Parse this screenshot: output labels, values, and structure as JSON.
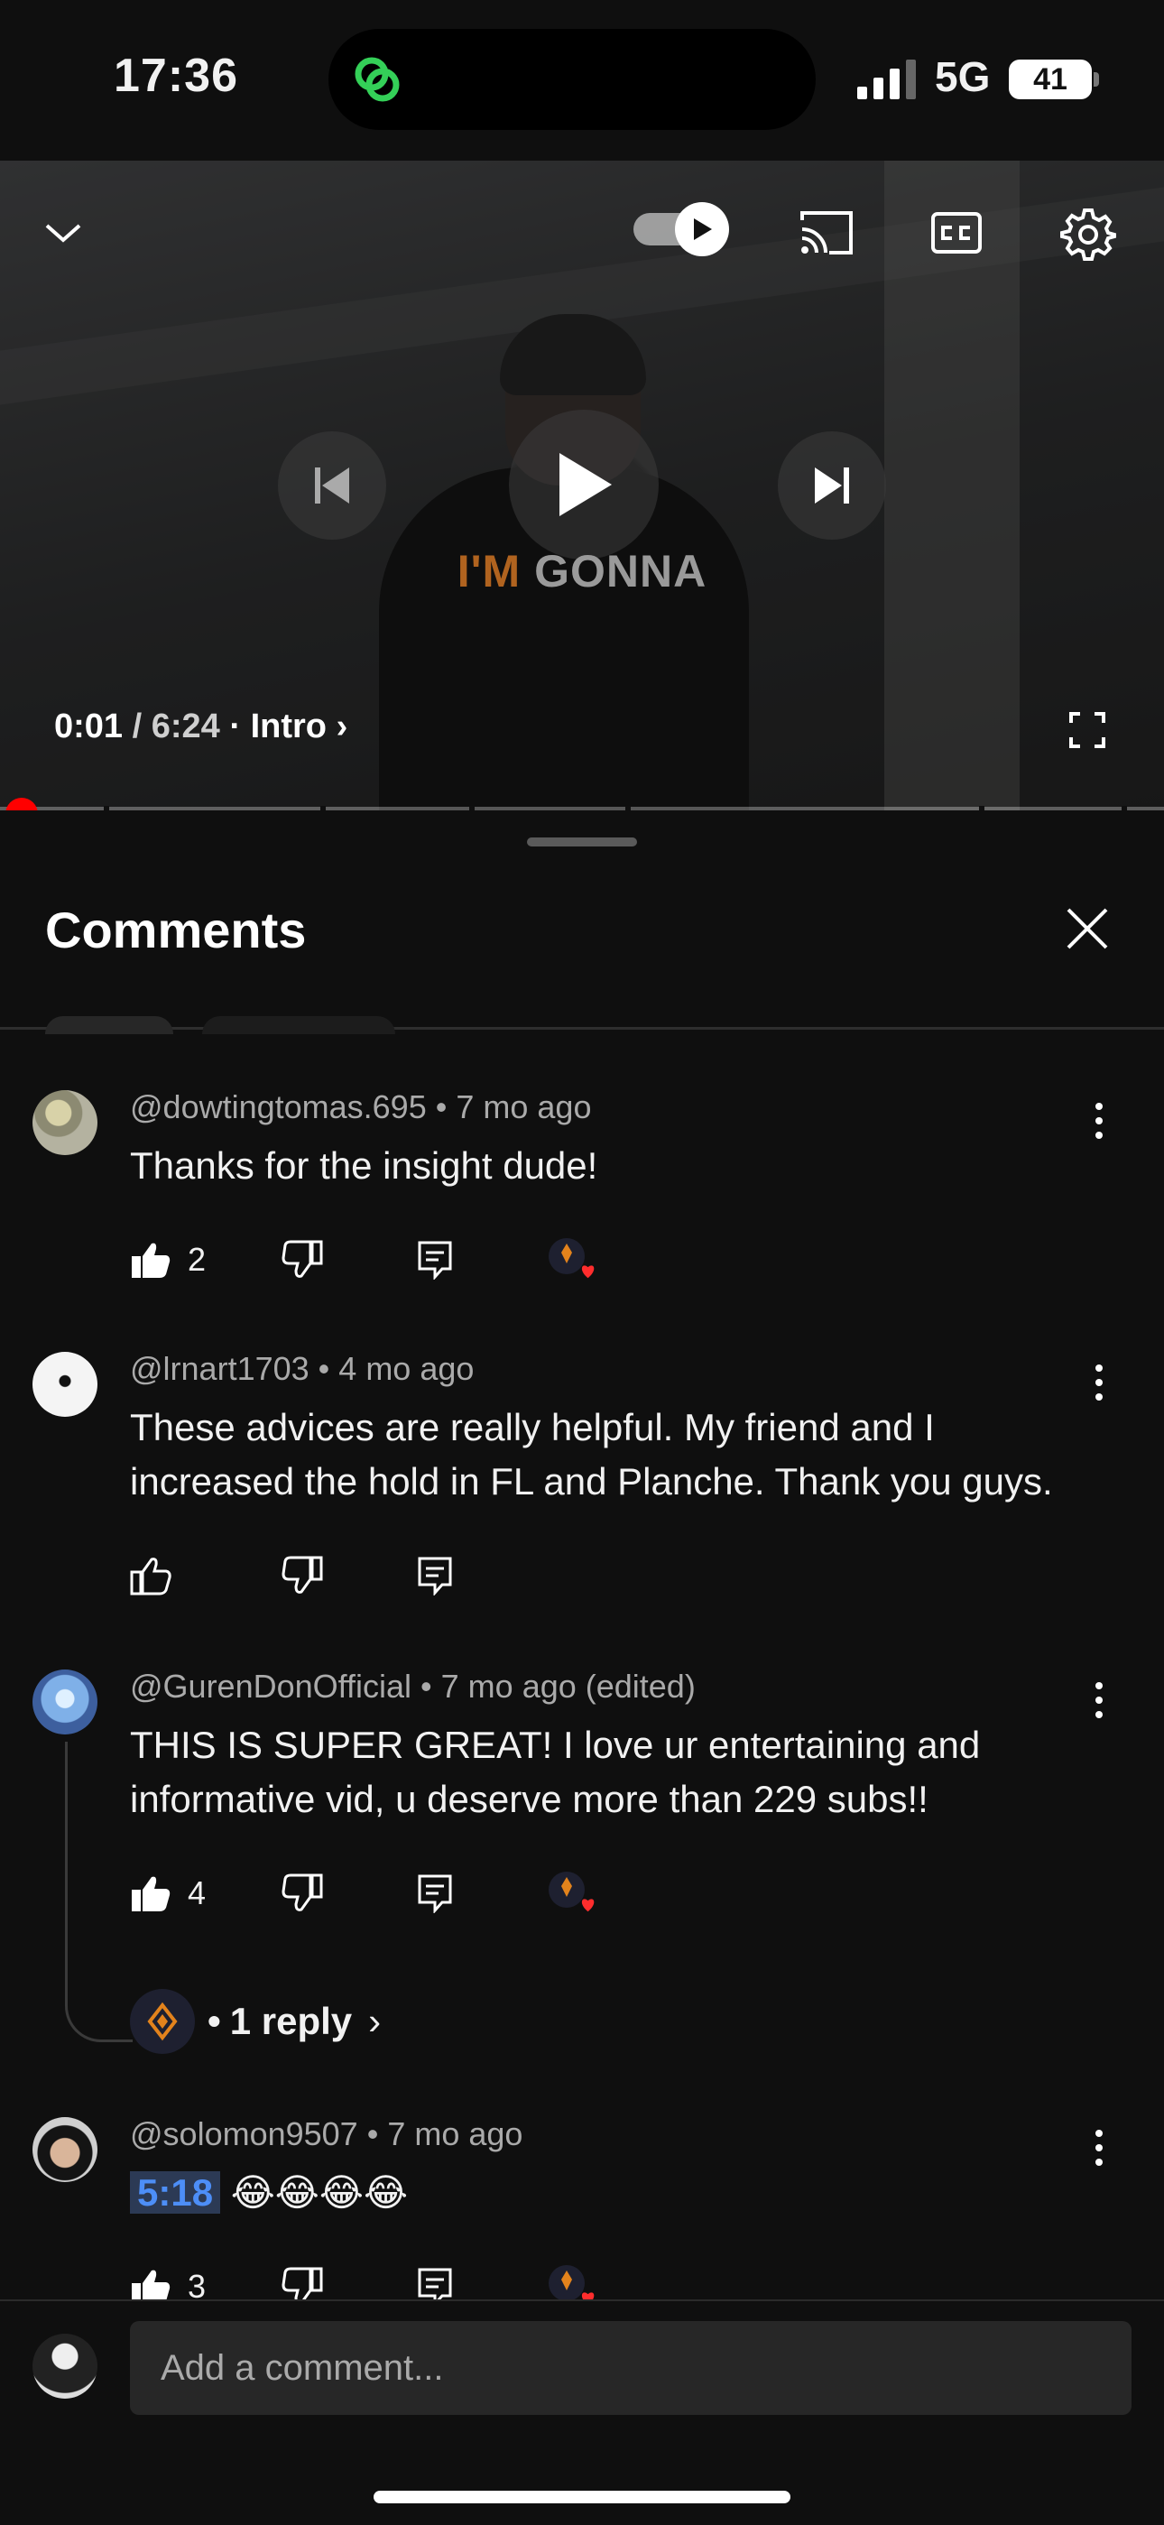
{
  "status_bar": {
    "time": "17:36",
    "network": "5G",
    "battery": "41"
  },
  "player": {
    "caption_part1": "I'M",
    "caption_part2": "GONNA",
    "time_current": "0:01",
    "time_separator": "/",
    "time_total": "6:24",
    "chapter_separator": "·",
    "chapter": "Intro",
    "chapter_chevron": "›",
    "progress_fraction": 0.003
  },
  "comments_panel": {
    "title": "Comments",
    "comments": [
      {
        "author": "@dowtingtomas.695",
        "age": "7 mo ago",
        "text": "Thanks for the insight dude!",
        "likes": "2",
        "liked": true,
        "creator_heart": true
      },
      {
        "author": "@lrnart1703",
        "age": "4 mo ago",
        "text": "These advices are really helpful. My friend and I increased the hold in FL and Planche. Thank you guys.",
        "likes": "",
        "liked": false,
        "creator_heart": false
      },
      {
        "author": "@GurenDonOfficial",
        "age": "7 mo ago (edited)",
        "text": "THIS IS SUPER GREAT! I love ur entertaining and informative vid, u deserve more than 229 subs!!",
        "likes": "4",
        "liked": true,
        "creator_heart": true,
        "replies": "1 reply"
      },
      {
        "author": "@solomon9507",
        "age": "7 mo ago",
        "timestamp_link": "5:18",
        "text": "😂😂😂😂",
        "likes": "3",
        "liked": true,
        "creator_heart": true
      }
    ],
    "meta_separator": "•",
    "reply_prefix": "•",
    "reply_chevron": "›"
  },
  "composer": {
    "placeholder": "Add a comment..."
  },
  "colors": {
    "background": "#0f0f0f",
    "progress": "#ff0000",
    "heart": "#ff2d2d",
    "timestamp_link": "#4d8ef7"
  },
  "icons": [
    "collapse-chevron-icon",
    "autoplay-icon",
    "cast-icon",
    "cc-icon",
    "settings-gear-icon",
    "previous-icon",
    "play-icon",
    "next-icon",
    "fullscreen-icon",
    "close-icon",
    "thumb-up-icon",
    "thumb-down-icon",
    "reply-icon",
    "creator-heart-icon",
    "more-vert-icon"
  ]
}
